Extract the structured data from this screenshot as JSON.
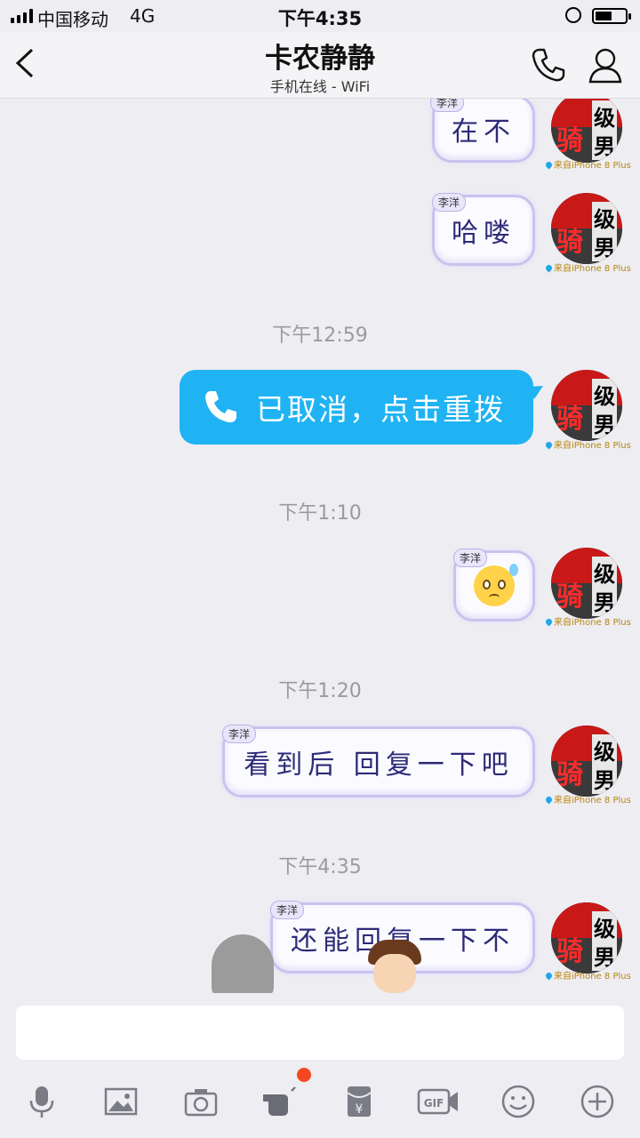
{
  "status_bar": {
    "carrier": "中国移动",
    "network": "4G",
    "time": "下午4:35",
    "battery_level": 0.55
  },
  "header": {
    "title": "卡农静静",
    "subtitle": "手机在线 - WiFi"
  },
  "from_label": "来自iPhone 8 Plus",
  "avatar_text": {
    "main": "骑",
    "a": "级",
    "b": "男"
  },
  "messages": [
    {
      "text": "在不",
      "tag": "李洋"
    },
    {
      "text": "哈喽",
      "tag": "李洋"
    },
    {
      "time": "下午12:59"
    },
    {
      "text": "已取消，点击重拨"
    },
    {
      "time": "下午1:10"
    },
    {
      "tag": "李洋",
      "emoji": "anxious-sweat-emoji"
    },
    {
      "time": "下午1:20"
    },
    {
      "text": "看到后 回复一下吧",
      "tag": "李洋"
    },
    {
      "time": "下午4:35"
    },
    {
      "text": "还能回复一下不",
      "tag": "李洋"
    }
  ],
  "toolbar": {
    "items": [
      "microphone-icon",
      "image-icon",
      "camera-icon",
      "poke-icon",
      "red-packet-icon",
      "gif-icon",
      "emoji-icon",
      "plus-icon"
    ],
    "gif_label": "GIF",
    "red_packet_symbol": "¥"
  },
  "colors": {
    "call_bubble": "#1fb3f3",
    "background": "#ededf2",
    "badge": "#f4471f"
  }
}
